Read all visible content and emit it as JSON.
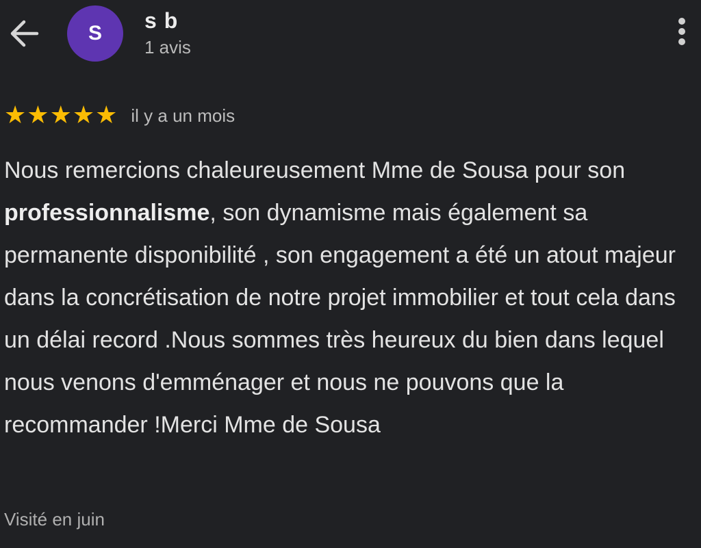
{
  "header": {
    "back_icon": "arrow-left-icon",
    "avatar_letter": "S",
    "avatar_color": "#5e35b1",
    "user_name": "s b",
    "review_count": "1 avis",
    "menu_icon": "more-vert-icon"
  },
  "review": {
    "rating": 5,
    "max_rating": 5,
    "star_color": "#fbbc04",
    "date": "il y a un mois",
    "text_before_bold": "Nous remercions chaleureusement Mme de Sousa pour son ",
    "text_bold": "professionnalisme",
    "text_after_bold": ", son dynamisme mais également sa permanente disponibilité , son engagement a été un atout majeur dans la concrétisation de notre projet immobilier et tout cela dans un délai record .Nous sommes très heureux du bien dans lequel nous venons d'emménager et nous ne pouvons que la recommander !Merci Mme de Sousa",
    "visited": "Visité en juin"
  }
}
